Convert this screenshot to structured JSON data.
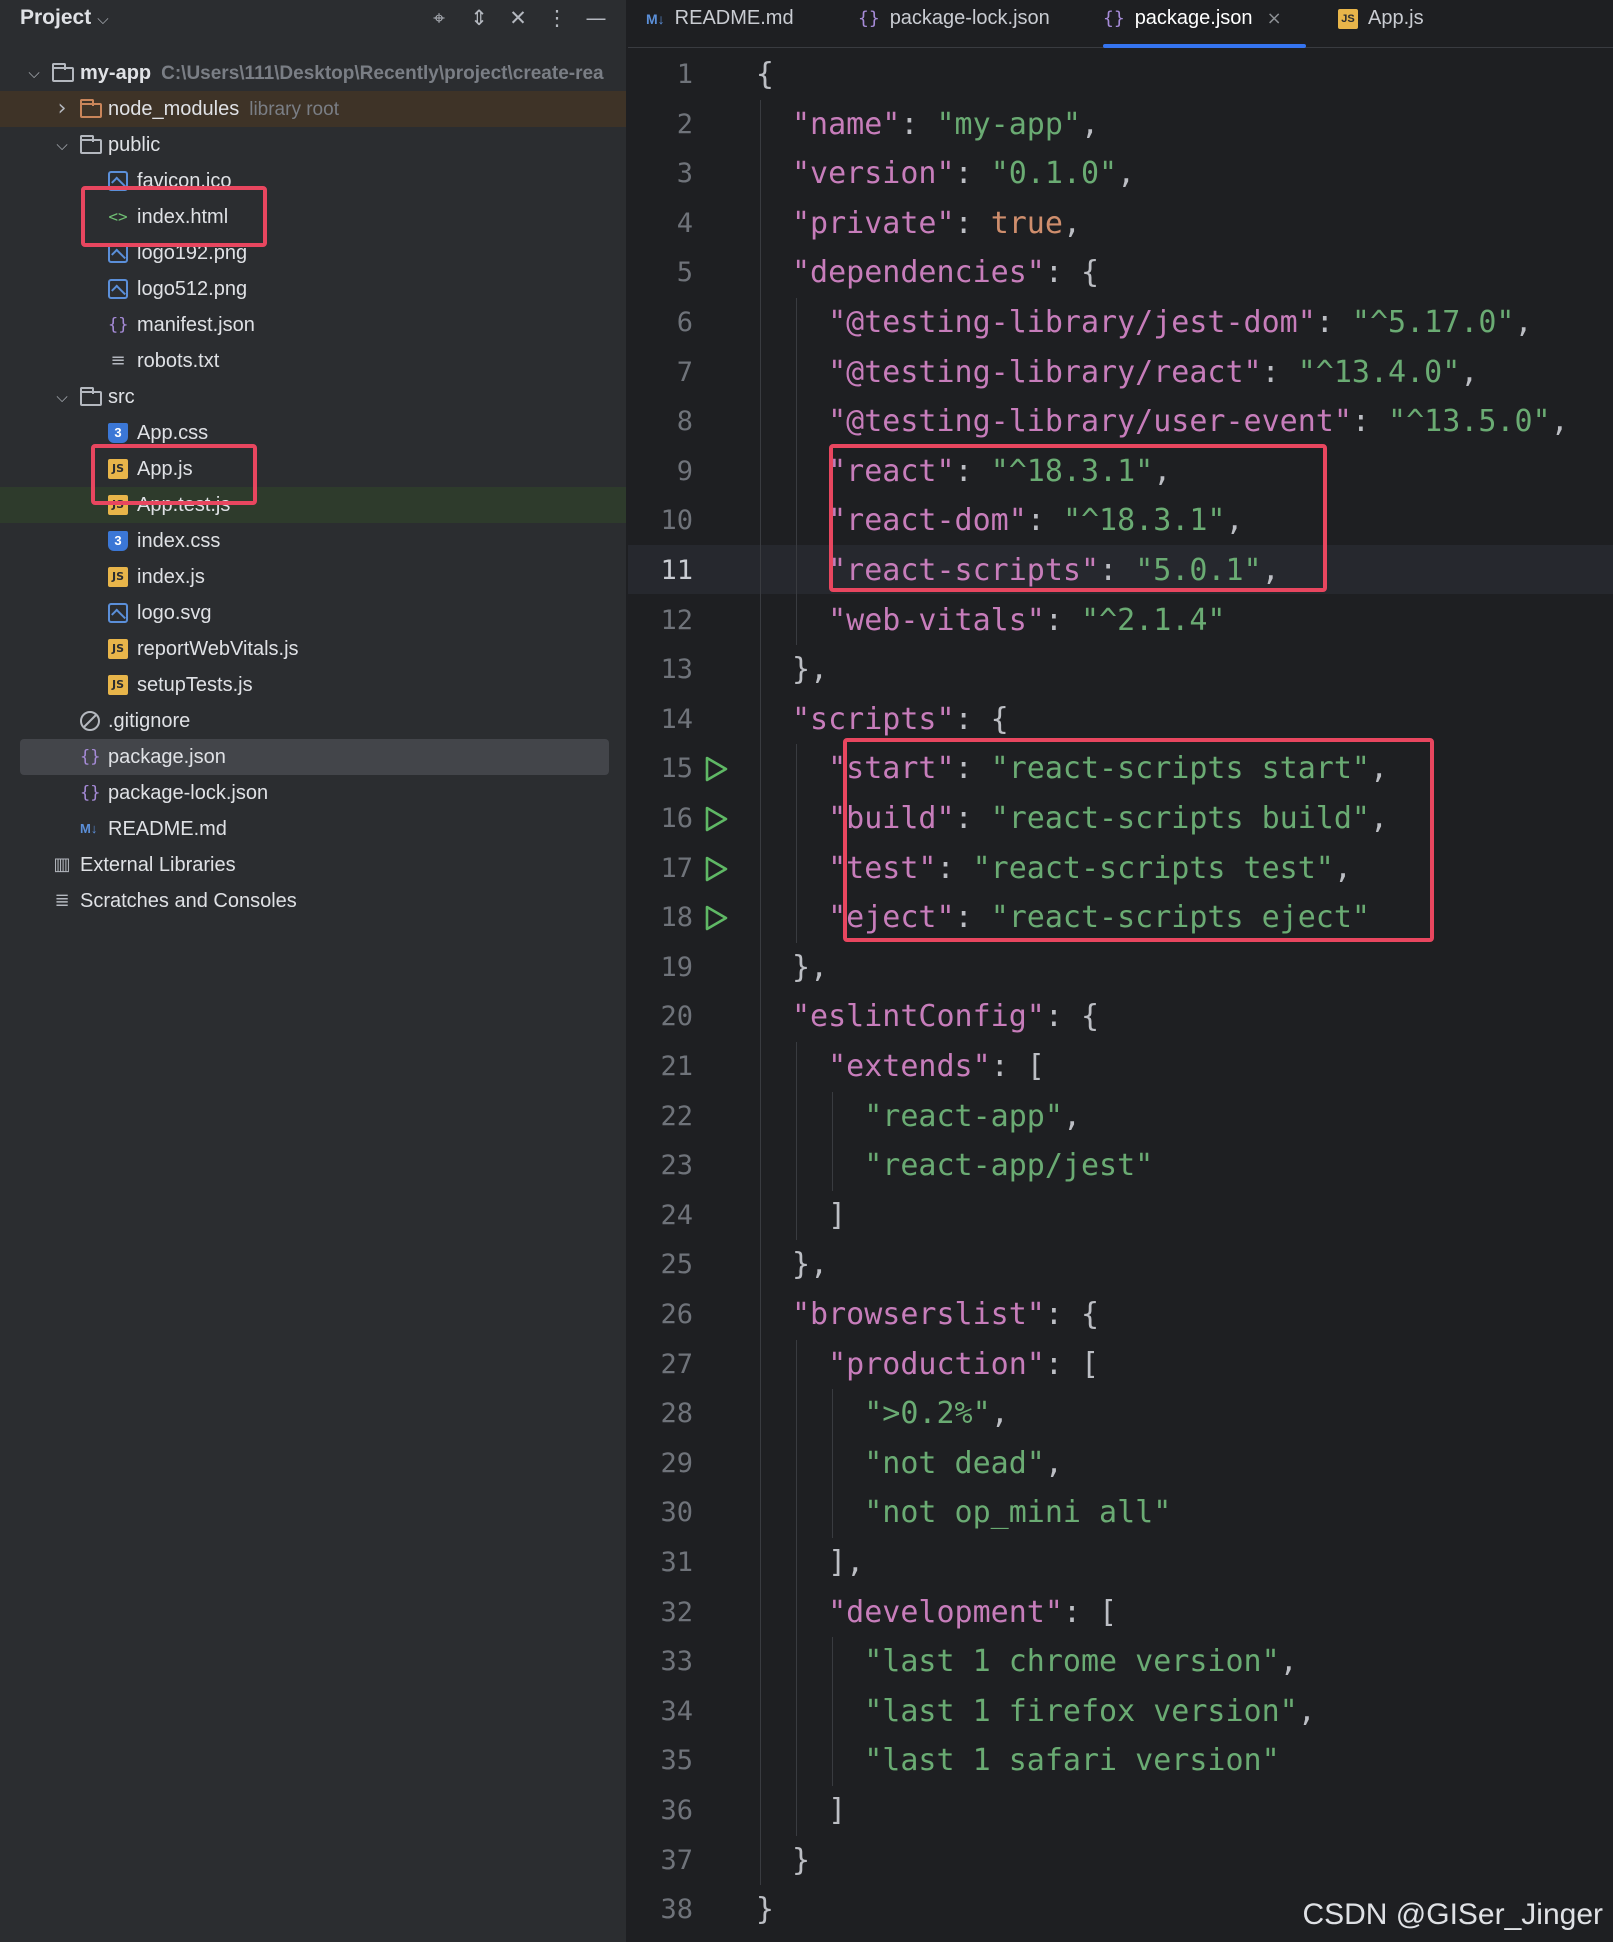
{
  "project_panel": {
    "title": "Project",
    "header_icons": [
      "crosshair-icon",
      "expand-icon",
      "collapse-icon",
      "more-icon",
      "minimize-icon"
    ],
    "tree": [
      {
        "label": "my-app",
        "hint": "C:\\Users\\111\\Desktop\\Recently\\project\\create-rea",
        "depth": 0,
        "icon": "folder",
        "expanded": true,
        "bold": true
      },
      {
        "label": "node_modules",
        "hint": "library root",
        "depth": 1,
        "icon": "folder-orange",
        "expanded": false,
        "row_style": "nm"
      },
      {
        "label": "public",
        "hint": "",
        "depth": 1,
        "icon": "folder",
        "expanded": true
      },
      {
        "label": "favicon.ico",
        "hint": "",
        "depth": 2,
        "icon": "image"
      },
      {
        "label": "index.html",
        "hint": "",
        "depth": 2,
        "icon": "html"
      },
      {
        "label": "logo192.png",
        "hint": "",
        "depth": 2,
        "icon": "image"
      },
      {
        "label": "logo512.png",
        "hint": "",
        "depth": 2,
        "icon": "image"
      },
      {
        "label": "manifest.json",
        "hint": "",
        "depth": 2,
        "icon": "json"
      },
      {
        "label": "robots.txt",
        "hint": "",
        "depth": 2,
        "icon": "text"
      },
      {
        "label": "src",
        "hint": "",
        "depth": 1,
        "icon": "folder",
        "expanded": true
      },
      {
        "label": "App.css",
        "hint": "",
        "depth": 2,
        "icon": "css"
      },
      {
        "label": "App.js",
        "hint": "",
        "depth": 2,
        "icon": "js"
      },
      {
        "label": "App.test.js",
        "hint": "",
        "depth": 2,
        "icon": "js",
        "row_style": "test"
      },
      {
        "label": "index.css",
        "hint": "",
        "depth": 2,
        "icon": "css"
      },
      {
        "label": "index.js",
        "hint": "",
        "depth": 2,
        "icon": "js"
      },
      {
        "label": "logo.svg",
        "hint": "",
        "depth": 2,
        "icon": "image"
      },
      {
        "label": "reportWebVitals.js",
        "hint": "",
        "depth": 2,
        "icon": "js"
      },
      {
        "label": "setupTests.js",
        "hint": "",
        "depth": 2,
        "icon": "js"
      },
      {
        "label": ".gitignore",
        "hint": "",
        "depth": 1,
        "icon": "ignore"
      },
      {
        "label": "package.json",
        "hint": "",
        "depth": 1,
        "icon": "json",
        "selected": true
      },
      {
        "label": "package-lock.json",
        "hint": "",
        "depth": 1,
        "icon": "json"
      },
      {
        "label": "README.md",
        "hint": "",
        "depth": 1,
        "icon": "md"
      },
      {
        "label": "External Libraries",
        "hint": "",
        "depth": 0,
        "icon": "library",
        "no_arrow": true
      },
      {
        "label": "Scratches and Consoles",
        "hint": "",
        "depth": 0,
        "icon": "scratch",
        "no_arrow": true
      }
    ]
  },
  "editor": {
    "tabs": [
      {
        "label": "README.md",
        "icon": "md",
        "active": false
      },
      {
        "label": "package-lock.json",
        "icon": "json",
        "active": false
      },
      {
        "label": "package.json",
        "icon": "json",
        "active": true,
        "closable": true
      },
      {
        "label": "App.js",
        "icon": "js",
        "active": false
      }
    ],
    "current_line": 11,
    "run_lines": [
      15,
      16,
      17,
      18
    ],
    "lines": [
      [
        [
          "p",
          "{"
        ]
      ],
      [
        [
          "p",
          "  "
        ],
        [
          "k",
          "\"name\""
        ],
        [
          "p",
          ": "
        ],
        [
          "s",
          "\"my-app\""
        ],
        [
          "p",
          ","
        ]
      ],
      [
        [
          "p",
          "  "
        ],
        [
          "k",
          "\"version\""
        ],
        [
          "p",
          ": "
        ],
        [
          "s",
          "\"0.1.0\""
        ],
        [
          "p",
          ","
        ]
      ],
      [
        [
          "p",
          "  "
        ],
        [
          "k",
          "\"private\""
        ],
        [
          "p",
          ": "
        ],
        [
          "b",
          "true"
        ],
        [
          "p",
          ","
        ]
      ],
      [
        [
          "p",
          "  "
        ],
        [
          "k",
          "\"dependencies\""
        ],
        [
          "p",
          ": {"
        ]
      ],
      [
        [
          "p",
          "    "
        ],
        [
          "k",
          "\"@testing-library/jest-dom\""
        ],
        [
          "p",
          ": "
        ],
        [
          "s",
          "\"^5.17.0\""
        ],
        [
          "p",
          ","
        ]
      ],
      [
        [
          "p",
          "    "
        ],
        [
          "k",
          "\"@testing-library/react\""
        ],
        [
          "p",
          ": "
        ],
        [
          "s",
          "\"^13.4.0\""
        ],
        [
          "p",
          ","
        ]
      ],
      [
        [
          "p",
          "    "
        ],
        [
          "k",
          "\"@testing-library/user-event\""
        ],
        [
          "p",
          ": "
        ],
        [
          "s",
          "\"^13.5.0\""
        ],
        [
          "p",
          ","
        ]
      ],
      [
        [
          "p",
          "    "
        ],
        [
          "k",
          "\"react\""
        ],
        [
          "p",
          ": "
        ],
        [
          "s",
          "\"^18.3.1\""
        ],
        [
          "p",
          ","
        ]
      ],
      [
        [
          "p",
          "    "
        ],
        [
          "k",
          "\"react-dom\""
        ],
        [
          "p",
          ": "
        ],
        [
          "s",
          "\"^18.3.1\""
        ],
        [
          "p",
          ","
        ]
      ],
      [
        [
          "p",
          "    "
        ],
        [
          "k",
          "\"react-scripts\""
        ],
        [
          "p",
          ": "
        ],
        [
          "s",
          "\"5.0.1\""
        ],
        [
          "p",
          ","
        ]
      ],
      [
        [
          "p",
          "    "
        ],
        [
          "k",
          "\"web-vitals\""
        ],
        [
          "p",
          ": "
        ],
        [
          "s",
          "\"^2.1.4\""
        ]
      ],
      [
        [
          "p",
          "  },"
        ]
      ],
      [
        [
          "p",
          "  "
        ],
        [
          "k",
          "\"scripts\""
        ],
        [
          "p",
          ": {"
        ]
      ],
      [
        [
          "p",
          "    "
        ],
        [
          "k",
          "\"start\""
        ],
        [
          "p",
          ": "
        ],
        [
          "s",
          "\"react-scripts start\""
        ],
        [
          "p",
          ","
        ]
      ],
      [
        [
          "p",
          "    "
        ],
        [
          "k",
          "\"build\""
        ],
        [
          "p",
          ": "
        ],
        [
          "s",
          "\"react-scripts build\""
        ],
        [
          "p",
          ","
        ]
      ],
      [
        [
          "p",
          "    "
        ],
        [
          "k",
          "\"test\""
        ],
        [
          "p",
          ": "
        ],
        [
          "s",
          "\"react-scripts test\""
        ],
        [
          "p",
          ","
        ]
      ],
      [
        [
          "p",
          "    "
        ],
        [
          "k",
          "\"eject\""
        ],
        [
          "p",
          ": "
        ],
        [
          "s",
          "\"react-scripts eject\""
        ]
      ],
      [
        [
          "p",
          "  },"
        ]
      ],
      [
        [
          "p",
          "  "
        ],
        [
          "k",
          "\"eslintConfig\""
        ],
        [
          "p",
          ": {"
        ]
      ],
      [
        [
          "p",
          "    "
        ],
        [
          "k",
          "\"extends\""
        ],
        [
          "p",
          ": ["
        ]
      ],
      [
        [
          "p",
          "      "
        ],
        [
          "s",
          "\"react-app\""
        ],
        [
          "p",
          ","
        ]
      ],
      [
        [
          "p",
          "      "
        ],
        [
          "s",
          "\"react-app/jest\""
        ]
      ],
      [
        [
          "p",
          "    ]"
        ]
      ],
      [
        [
          "p",
          "  },"
        ]
      ],
      [
        [
          "p",
          "  "
        ],
        [
          "k",
          "\"browserslist\""
        ],
        [
          "p",
          ": {"
        ]
      ],
      [
        [
          "p",
          "    "
        ],
        [
          "k",
          "\"production\""
        ],
        [
          "p",
          ": ["
        ]
      ],
      [
        [
          "p",
          "      "
        ],
        [
          "s",
          "\">0.2%\""
        ],
        [
          "p",
          ","
        ]
      ],
      [
        [
          "p",
          "      "
        ],
        [
          "s",
          "\"not dead\""
        ],
        [
          "p",
          ","
        ]
      ],
      [
        [
          "p",
          "      "
        ],
        [
          "s",
          "\"not op_mini all\""
        ]
      ],
      [
        [
          "p",
          "    ],"
        ]
      ],
      [
        [
          "p",
          "    "
        ],
        [
          "k",
          "\"development\""
        ],
        [
          "p",
          ": ["
        ]
      ],
      [
        [
          "p",
          "      "
        ],
        [
          "s",
          "\"last 1 chrome version\""
        ],
        [
          "p",
          ","
        ]
      ],
      [
        [
          "p",
          "      "
        ],
        [
          "s",
          "\"last 1 firefox version\""
        ],
        [
          "p",
          ","
        ]
      ],
      [
        [
          "p",
          "      "
        ],
        [
          "s",
          "\"last 1 safari version\""
        ]
      ],
      [
        [
          "p",
          "    ]"
        ]
      ],
      [
        [
          "p",
          "  }"
        ]
      ],
      [
        [
          "p",
          "}"
        ]
      ]
    ]
  },
  "watermark": "CSDN @GISer_Jinger",
  "colors": {
    "panel_bg": "#2b2d30",
    "editor_bg": "#1e1f22",
    "key": "#c77dbb",
    "string": "#6aab73",
    "boolean": "#cf8e6d",
    "highlight_box": "#e8465f",
    "run_icon": "#5fb865"
  }
}
